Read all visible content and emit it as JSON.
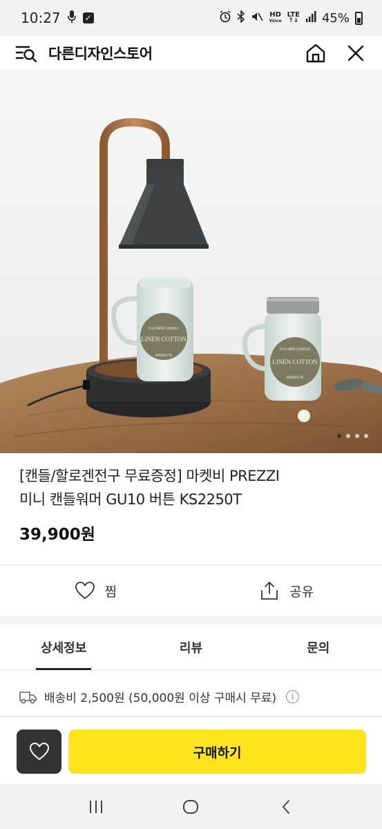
{
  "status_bar": {
    "time": "10:27",
    "network_hd": "HD",
    "network_voice": "Voice",
    "network_lte": "LTE",
    "battery": "45%"
  },
  "header": {
    "store_name": "다른디자인스토어"
  },
  "product_image": {
    "jar_label_brand": "KILA MINI CANDLE",
    "jar_label_name": "LINEN COTTON",
    "jar_label_maker": "MARKETB",
    "carousel_total": 4,
    "carousel_active_index": 1
  },
  "product": {
    "name_line1": "[캔들/할로겐전구 무료증정] 마켓비 PREZZI",
    "name_line2": "미니 캔들워머 GU10 버튼 KS2250T",
    "price": "39,900원"
  },
  "actions": {
    "wish_label": "찜",
    "share_label": "공유"
  },
  "tabs": [
    {
      "label": "상세정보",
      "active": true
    },
    {
      "label": "리뷰",
      "active": false
    },
    {
      "label": "문의",
      "active": false
    }
  ],
  "shipping": {
    "text": "배송비 2,500원 (50,000원 이상 구매시 무료)",
    "info_glyph": "i"
  },
  "bottom_bar": {
    "buy_label": "구매하기"
  },
  "colors": {
    "buy_button": "#fee31d",
    "wish_button": "#333333"
  }
}
